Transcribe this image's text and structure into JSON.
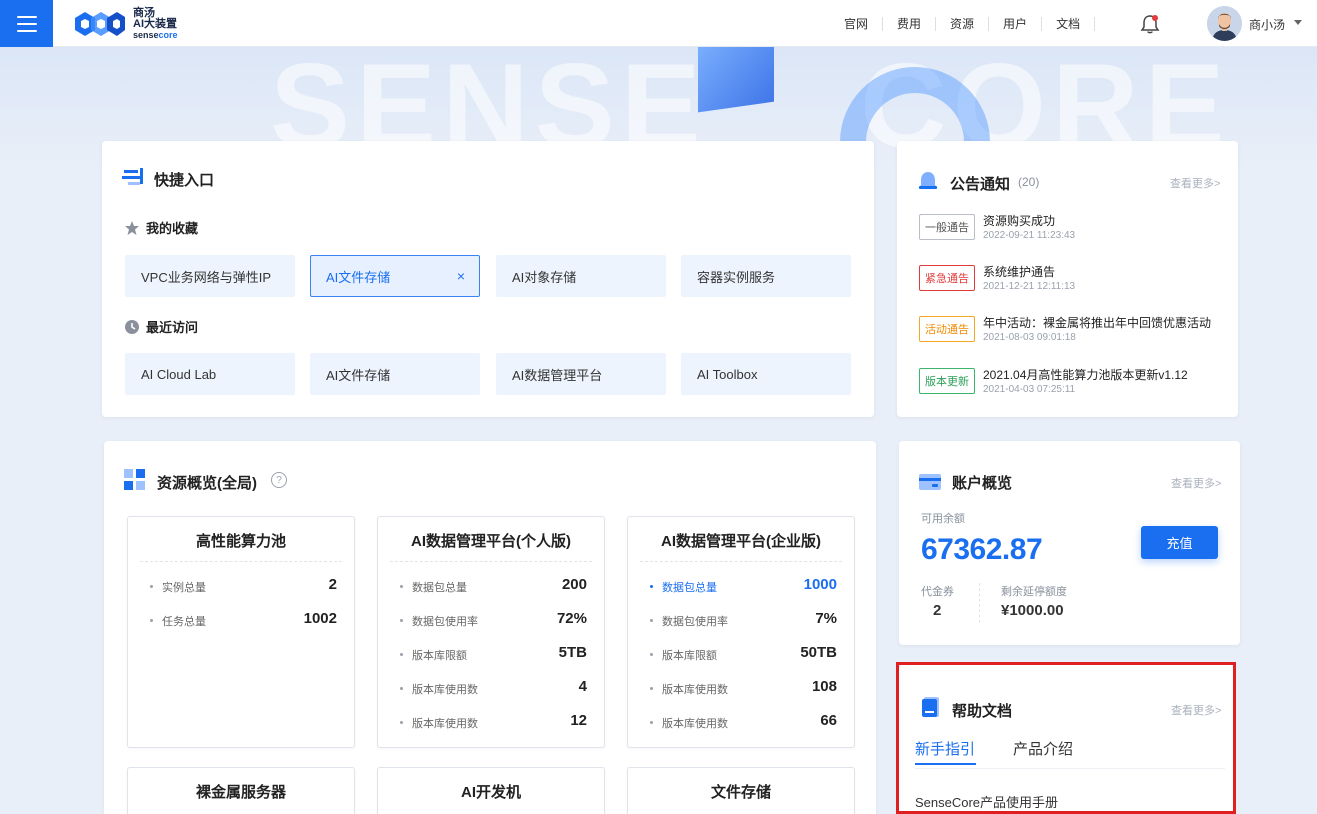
{
  "header": {
    "logo": {
      "line1": "商汤",
      "line2": "AI大装置",
      "line3a": "sense",
      "line3b": "core"
    },
    "nav": [
      "官网",
      "费用",
      "资源",
      "用户",
      "文档"
    ],
    "user_name": "商小汤"
  },
  "quick_entry": {
    "title": "快捷入口",
    "favorites_title": "我的收藏",
    "favorites": [
      "VPC业务网络与弹性IP",
      "AI文件存储",
      "AI对象存储",
      "容器实例服务"
    ],
    "favorites_close": "×",
    "recent_title": "最近访问",
    "recent": [
      "AI Cloud Lab",
      "AI文件存储",
      "AI数据管理平台",
      "AI Toolbox"
    ]
  },
  "notices": {
    "title": "公告通知",
    "count": "(20)",
    "more": "查看更多>",
    "items": [
      {
        "tag": "一般通告",
        "title": "资源购买成功",
        "time": "2022-09-21  11:23:43"
      },
      {
        "tag": "紧急通告",
        "title": "系统维护通告",
        "time": "2021-12-21  12:11:13"
      },
      {
        "tag": "活动通告",
        "title": "年中活动：裸金属将推出年中回馈优惠活动",
        "time": "2021-08-03  09:01:18"
      },
      {
        "tag": "版本更新",
        "title": "2021.04月高性能算力池版本更新v1.12",
        "time": "2021-04-03  07:25:11"
      }
    ]
  },
  "resources": {
    "title": "资源概览(全局)",
    "help_mark": "?",
    "boxes": [
      {
        "title": "高性能算力池",
        "rows": [
          {
            "label": "实例总量",
            "value": "2"
          },
          {
            "label": "任务总量",
            "value": "1002"
          }
        ]
      },
      {
        "title": "AI数据管理平台(个人版)",
        "rows": [
          {
            "label": "数据包总量",
            "value": "200"
          },
          {
            "label": "数据包使用率",
            "value": "72%"
          },
          {
            "label": "版本库限额",
            "value": "5TB"
          },
          {
            "label": "版本库使用数",
            "value": "4"
          },
          {
            "label": "版本库使用数",
            "value": "12"
          }
        ]
      },
      {
        "title": "AI数据管理平台(企业版)",
        "rows": [
          {
            "label": "数据包总量",
            "value": "1000"
          },
          {
            "label": "数据包使用率",
            "value": "7%"
          },
          {
            "label": "版本库限额",
            "value": "50TB"
          },
          {
            "label": "版本库使用数",
            "value": "108"
          },
          {
            "label": "版本库使用数",
            "value": "66"
          }
        ]
      },
      {
        "title": "裸金属服务器"
      },
      {
        "title": "AI开发机"
      },
      {
        "title": "文件存储"
      }
    ]
  },
  "account": {
    "title": "账户概览",
    "more": "查看更多>",
    "balance_label": "可用余额",
    "balance": "67362.87",
    "recharge": "充值",
    "voucher_label": "代金券",
    "voucher": "2",
    "credit_label": "剩余延停额度",
    "credit": "¥1000.00"
  },
  "help": {
    "title": "帮助文档",
    "more": "查看更多>",
    "tabs": [
      "新手指引",
      "产品介绍"
    ],
    "link": "SenseCore产品使用手册"
  },
  "colors": {
    "accent": "#1a6ef0",
    "urgent": "#e33b3b",
    "activity": "#f08a00",
    "update": "#2fa05b",
    "highlight_outline": "#e02020"
  }
}
